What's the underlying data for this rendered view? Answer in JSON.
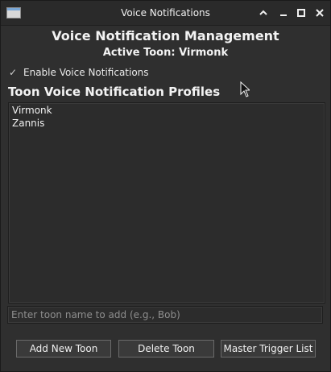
{
  "window": {
    "title": "Voice Notifications",
    "controls": {
      "collapse_icon": "chevron-up-icon",
      "minimize_icon": "minimize-icon",
      "maximize_icon": "maximize-icon",
      "close_icon": "close-icon"
    }
  },
  "header": {
    "title": "Voice Notification Management",
    "active_toon": "Active Toon: Virmonk"
  },
  "settings": {
    "enable_label": "Enable Voice Notifications",
    "enabled": true
  },
  "profiles": {
    "title": "Toon Voice Notification Profiles",
    "items": [
      {
        "label": "Virmonk"
      },
      {
        "label": "Zannis"
      }
    ]
  },
  "add_toon": {
    "value": "",
    "placeholder": "Enter toon name to add (e.g., Bob)"
  },
  "actions": {
    "add_label": "Add New Toon",
    "delete_label": "Delete Toon",
    "master_label": "Master Trigger List"
  },
  "colors": {
    "background": "#2f2f2f",
    "text": "#f3f3f3",
    "placeholder": "#8e8e8e",
    "button_border": "#6a6a6a"
  }
}
